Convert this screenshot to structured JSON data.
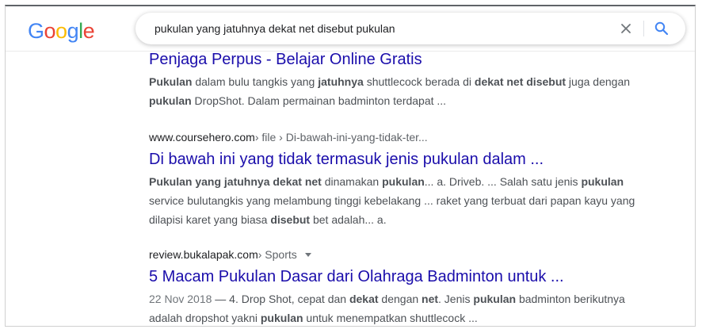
{
  "logo": {
    "letters": [
      "G",
      "o",
      "o",
      "g",
      "l",
      "e"
    ],
    "colors": [
      "#4285F4",
      "#EA4335",
      "#FBBC05",
      "#4285F4",
      "#34A853",
      "#EA4335"
    ]
  },
  "search": {
    "query": "pukulan yang jatuhnya dekat net disebut pukulan"
  },
  "icons": {
    "clear": "close-icon",
    "search": "search-icon"
  },
  "results": [
    {
      "title": "Penjaga Perpus - Belajar Online Gratis",
      "snippet": [
        {
          "t": "Pukulan",
          "b": true
        },
        {
          "t": " dalam bulu tangkis yang ",
          "b": false
        },
        {
          "t": "jatuhnya",
          "b": true
        },
        {
          "t": " shuttlecock berada di ",
          "b": false
        },
        {
          "t": "dekat net disebut",
          "b": true
        },
        {
          "t": " juga dengan ",
          "b": false
        },
        {
          "t": "pukulan",
          "b": true
        },
        {
          "t": " DropShot. Dalam permainan badminton terdapat ...",
          "b": false
        }
      ]
    },
    {
      "domain": "www.coursehero.com",
      "path": " › file › Di-bawah-ini-yang-tidak-ter...",
      "title": "Di bawah ini yang tidak termasuk jenis pukulan dalam ...",
      "snippet": [
        {
          "t": "Pukulan yang jatuhnya dekat net",
          "b": true
        },
        {
          "t": " dinamakan ",
          "b": false
        },
        {
          "t": "pukulan",
          "b": true
        },
        {
          "t": "... a. Driveb. ... Salah satu jenis ",
          "b": false
        },
        {
          "t": "pukulan",
          "b": true
        },
        {
          "t": " service bulutangkis yang melambung tinggi kebelakang ... raket yang terbuat dari papan kayu yang dilapisi karet yang biasa ",
          "b": false
        },
        {
          "t": "disebut",
          "b": true
        },
        {
          "t": " bet adalah... a.",
          "b": false
        }
      ]
    },
    {
      "domain": "review.bukalapak.com",
      "path": " › Sports",
      "title": "5 Macam Pukulan Dasar dari Olahraga Badminton untuk ...",
      "date": "22 Nov 2018",
      "snippet": [
        {
          "t": " — 4. Drop Shot, cepat dan ",
          "b": false
        },
        {
          "t": "dekat",
          "b": true
        },
        {
          "t": " dengan ",
          "b": false
        },
        {
          "t": "net",
          "b": true
        },
        {
          "t": ". Jenis ",
          "b": false
        },
        {
          "t": "pukulan",
          "b": true
        },
        {
          "t": " badminton berikutnya adalah dropshot yakni ",
          "b": false
        },
        {
          "t": "pukulan",
          "b": true
        },
        {
          "t": " untuk menempatkan shuttlecock ...",
          "b": false
        }
      ]
    }
  ]
}
